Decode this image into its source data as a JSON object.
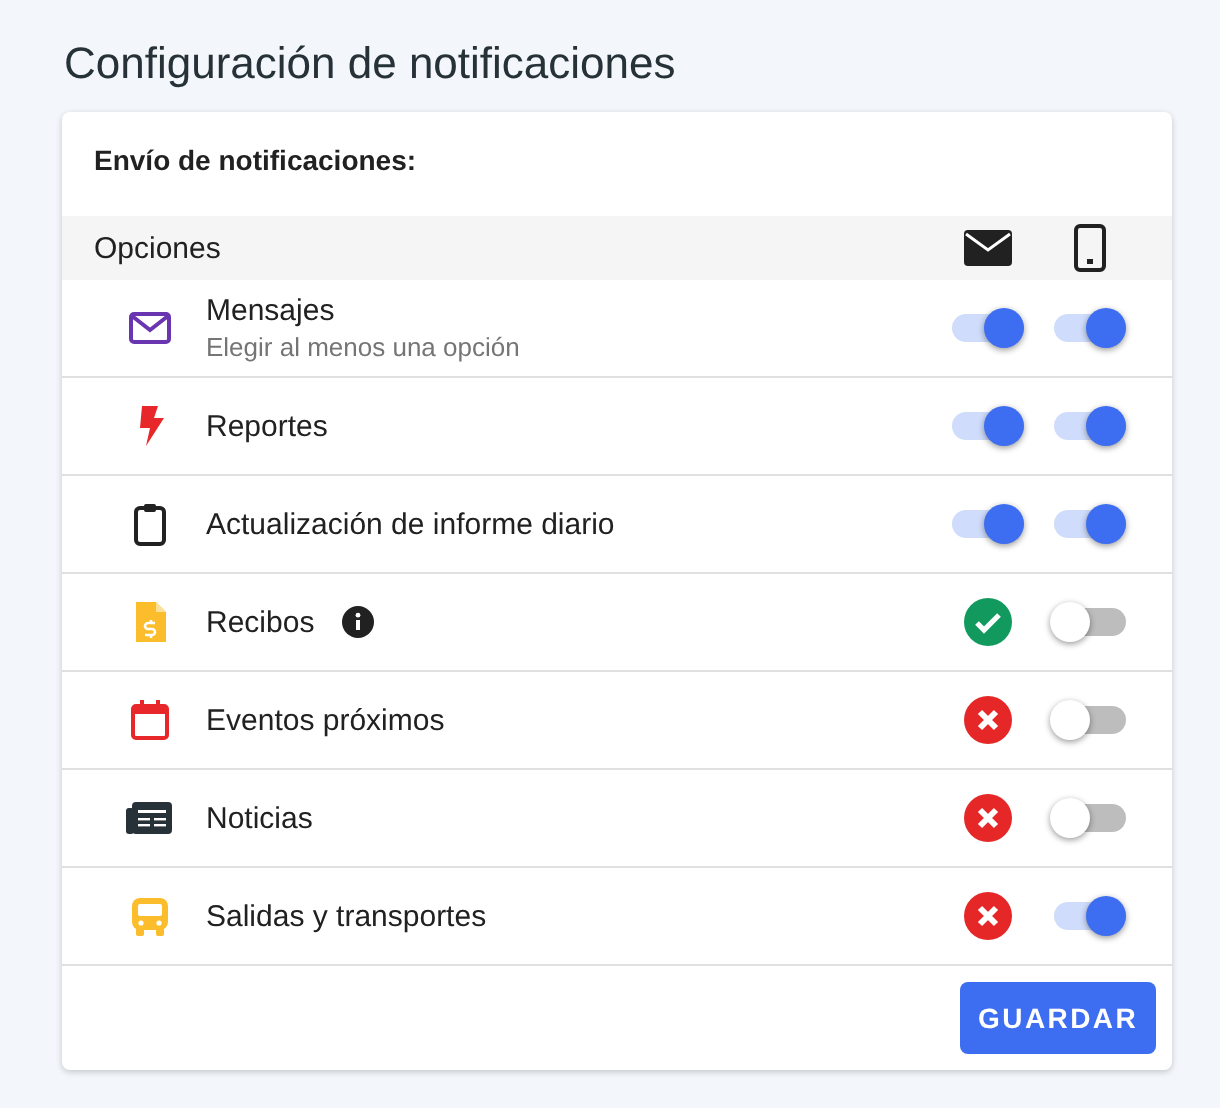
{
  "title": "Configuración de notificaciones",
  "card": {
    "heading": "Envío de notificaciones:",
    "options_label": "Opciones",
    "rows": [
      {
        "label": "Mensajes",
        "sublabel": "Elegir al menos una opción",
        "info": false,
        "email": {
          "kind": "switch",
          "on": true
        },
        "phone": {
          "kind": "switch",
          "on": true
        }
      },
      {
        "label": "Reportes",
        "info": false,
        "email": {
          "kind": "switch",
          "on": true
        },
        "phone": {
          "kind": "switch",
          "on": true
        }
      },
      {
        "label": "Actualización de informe diario",
        "info": false,
        "email": {
          "kind": "switch",
          "on": true
        },
        "phone": {
          "kind": "switch",
          "on": true
        }
      },
      {
        "label": "Recibos",
        "info": true,
        "email": {
          "kind": "status",
          "on": true
        },
        "phone": {
          "kind": "switch",
          "on": false
        }
      },
      {
        "label": "Eventos próximos",
        "info": false,
        "email": {
          "kind": "status",
          "on": false
        },
        "phone": {
          "kind": "switch",
          "on": false
        }
      },
      {
        "label": "Noticias",
        "info": false,
        "email": {
          "kind": "status",
          "on": false
        },
        "phone": {
          "kind": "switch",
          "on": false
        }
      },
      {
        "label": "Salidas y transportes",
        "info": false,
        "email": {
          "kind": "status",
          "on": false
        },
        "phone": {
          "kind": "switch",
          "on": true
        }
      }
    ],
    "save_button": "GUARDAR"
  }
}
